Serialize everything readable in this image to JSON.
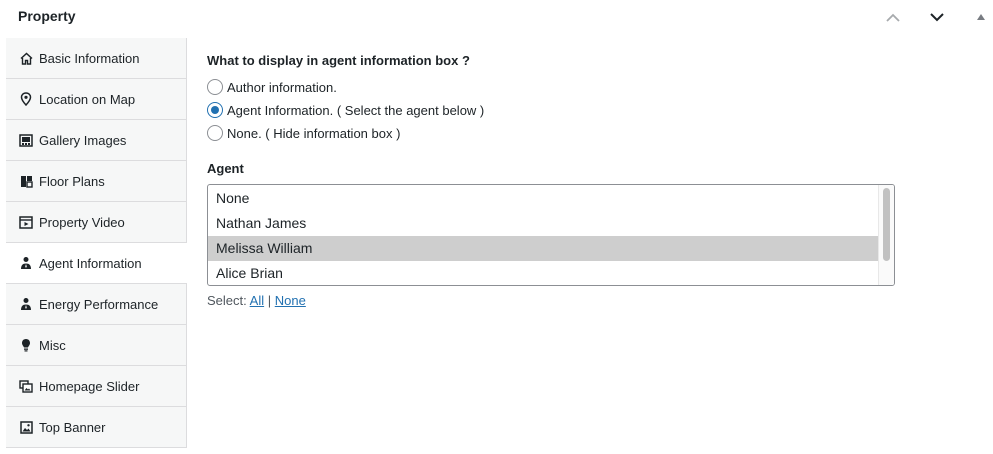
{
  "header": {
    "title": "Property"
  },
  "sidebar": {
    "items": [
      {
        "label": "Basic Information",
        "icon": "home-icon"
      },
      {
        "label": "Location on Map",
        "icon": "location-pin-icon"
      },
      {
        "label": "Gallery Images",
        "icon": "gallery-icon"
      },
      {
        "label": "Floor Plans",
        "icon": "floor-plan-icon"
      },
      {
        "label": "Property Video",
        "icon": "video-icon"
      },
      {
        "label": "Agent Information",
        "icon": "agent-icon"
      },
      {
        "label": "Energy Performance",
        "icon": "agent-icon"
      },
      {
        "label": "Misc",
        "icon": "lightbulb-icon"
      },
      {
        "label": "Homepage Slider",
        "icon": "slides-icon"
      },
      {
        "label": "Top Banner",
        "icon": "image-icon"
      }
    ],
    "active_index": 5
  },
  "main": {
    "question": "What to display in agent information box ?",
    "options": [
      {
        "label": "Author information.",
        "checked": false
      },
      {
        "label": "Agent Information. ( Select the agent below )",
        "checked": true
      },
      {
        "label": "None. ( Hide information box )",
        "checked": false
      }
    ],
    "agent_label": "Agent",
    "agents": [
      {
        "name": "None",
        "selected": false
      },
      {
        "name": "Nathan James",
        "selected": false
      },
      {
        "name": "Melissa William",
        "selected": true
      },
      {
        "name": "Alice Brian",
        "selected": false
      }
    ],
    "select": {
      "prefix": "Select:",
      "all": "All",
      "separator": "|",
      "none": "None"
    }
  },
  "colors": {
    "accent": "#2271b1",
    "selected_option_bg": "#cecece",
    "sidebar_bg": "#f6f7f7"
  }
}
